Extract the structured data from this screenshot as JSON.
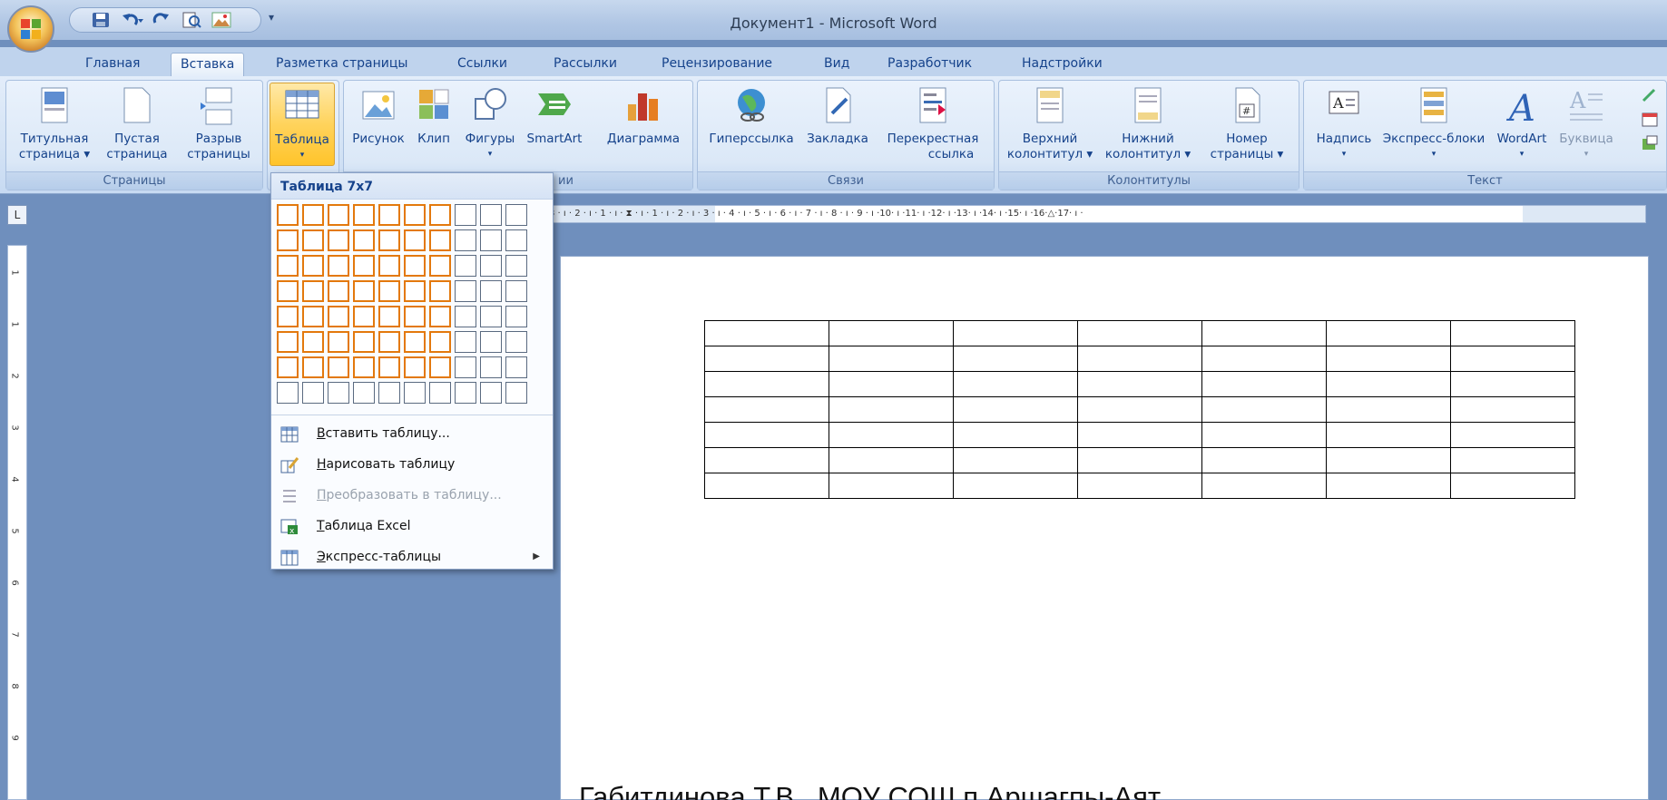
{
  "window": {
    "title": "Документ1 - Microsoft Word"
  },
  "qat": {
    "more": "▾"
  },
  "tabs": [
    {
      "label": "Главная"
    },
    {
      "label": "Вставка"
    },
    {
      "label": "Разметка страницы"
    },
    {
      "label": "Ссылки"
    },
    {
      "label": "Рассылки"
    },
    {
      "label": "Рецензирование"
    },
    {
      "label": "Вид"
    },
    {
      "label": "Разработчик"
    },
    {
      "label": "Надстройки"
    }
  ],
  "ribbon": {
    "pages": {
      "label": "Страницы",
      "cover_l1": "Титульная",
      "cover_l2": "страница ▾",
      "blank_l1": "Пустая",
      "blank_l2": "страница",
      "break_l1": "Разрыв",
      "break_l2": "страницы"
    },
    "tables": {
      "label": "Таблица",
      "arrow": "▾"
    },
    "illustrations": {
      "label_tail": "ии",
      "picture": "Рисунок",
      "clip": "Клип",
      "shapes": "Фигуры",
      "shapes_arrow": "▾",
      "smartart": "SmartArt",
      "chart": "Диаграмма"
    },
    "links": {
      "label": "Связи",
      "hyperlink": "Гиперссылка",
      "bookmark": "Закладка",
      "cross_l1": "Перекрестная",
      "cross_l2": "ссылка"
    },
    "headerfooter": {
      "label": "Колонтитулы",
      "header_l1": "Верхний",
      "header_l2": "колонтитул ▾",
      "footer_l1": "Нижний",
      "footer_l2": "колонтитул ▾",
      "pagenum_l1": "Номер",
      "pagenum_l2": "страницы ▾"
    },
    "text": {
      "label": "Текст",
      "textbox": "Надпись",
      "quickparts": "Экспресс-блоки",
      "wordart": "WordArt",
      "dropcap": "Буквица",
      "arrow": "▾"
    }
  },
  "ruler": {
    "corner": "L",
    "ticks": "3 · ı · 2 · ı · 1 · ı · ⧗ · ı · 1 · ı · 2 · ı · 3 · ı · 4 · ı · 5 · ı · 6 · ı · 7 · ı · 8 · ı · 9 · ı ·10· ı ·11· ı ·12· ı ·13· ı ·14· ı ·15· ı ·16·△·17· ı ·",
    "vticks": [
      "1",
      "1",
      "2",
      "3",
      "4",
      "5",
      "6",
      "7",
      "8",
      "9"
    ]
  },
  "table_menu": {
    "title": "Таблица 7x7",
    "selected_rows": 7,
    "selected_cols": 7,
    "grid_rows": 8,
    "grid_cols": 10,
    "items": [
      {
        "hotkey": "В",
        "rest": "ставить таблицу...",
        "disabled": false
      },
      {
        "hotkey": "Н",
        "rest": "арисовать таблицу",
        "disabled": false
      },
      {
        "hotkey": "П",
        "rest": "реобразовать в таблицу...",
        "disabled": true
      },
      {
        "hotkey": "Т",
        "rest": "аблица Excel",
        "disabled": false
      },
      {
        "hotkey": "Э",
        "rest": "кспресс-таблицы",
        "disabled": false,
        "submenu": "▶"
      }
    ]
  },
  "document": {
    "table_rows": 7,
    "table_cols": 7,
    "footer_text": "Габитдинова Т.В., МОУ СОШ п.Аршагпы-Аят"
  }
}
